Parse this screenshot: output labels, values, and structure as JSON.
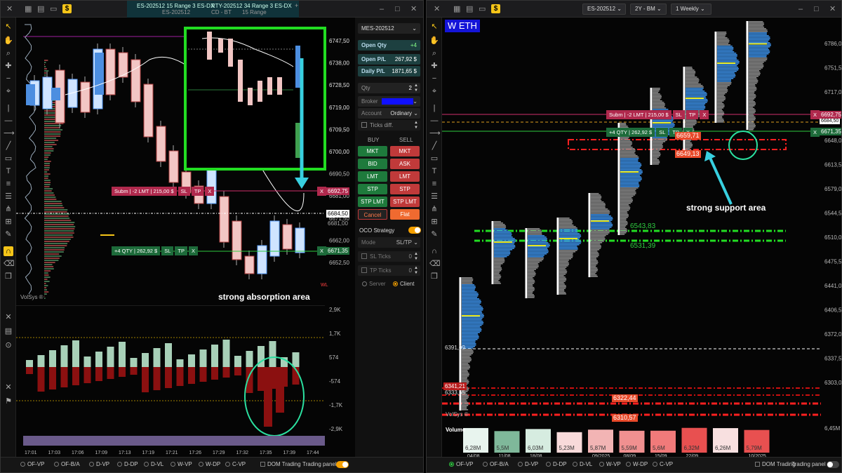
{
  "left_window": {
    "tabs": [
      "ES-202512 15 Range 3 ES-DX",
      "RTY-202512 34 Range 3 ES-DX"
    ],
    "sub_tabs": [
      "ES-202512",
      "CD - BT",
      "15 Range"
    ],
    "watermark": "VolSys ®",
    "annotation": "strong absorption area",
    "price_ticks": [
      "6747,50",
      "6738,00",
      "6728,50",
      "6719,00",
      "6709,50",
      "6700,00",
      "6690,50",
      "6681,00",
      "6671,50",
      "6662,00",
      "6652,50"
    ],
    "price_markers": {
      "p6692": "6692,75",
      "p6684": "6684,50",
      "p6671": "6671,35",
      "p6681": "6681,00",
      "wl": "WL"
    },
    "order_submit": {
      "label": "Subm | -2 LMT | 215,00 $",
      "sl": "SL",
      "tp": "TP",
      "x": "X"
    },
    "order_position": {
      "label": "+4 QTY | 262,92 $",
      "sl": "SL",
      "tp": "TP",
      "x": "X"
    },
    "delta_ticks": [
      "2,9K",
      "1,7K",
      "574",
      "-574",
      "-1,7K",
      "-2,9K"
    ],
    "time_ticks": [
      "17:01",
      "17:03",
      "17:06",
      "17:09",
      "17:13",
      "17:19",
      "17:21",
      "17:26",
      "17:29",
      "17:32",
      "17:35",
      "17:39",
      "17:44"
    ],
    "inset_ticks": [
      "6747,50",
      "6738,00",
      "6728,50",
      "6719,00",
      "6709,50",
      "6700,00"
    ],
    "bottom_items": [
      "OF-VP",
      "OF-B/A",
      "D-VP",
      "D-DP",
      "D-VL",
      "W-VP",
      "W-DP",
      "C-VP"
    ],
    "dom_trading": "DOM Trading",
    "trading_panel": "Trading panel"
  },
  "trading_panel": {
    "instrument": "MES-202512",
    "open_qty_label": "Open Qty",
    "open_qty_value": "+4",
    "open_pl_label": "Open P/L",
    "open_pl_value": "267,92 $",
    "daily_pl_label": "Daily P/L",
    "daily_pl_value": "1871,65 $",
    "qty_label": "Qty",
    "qty_value": "2",
    "broker_label": "Broker",
    "account_label": "Account",
    "account_value": "Ordinary",
    "ticks_diff_label": "Ticks diff.",
    "buy_label": "BUY",
    "sell_label": "SELL",
    "buy_buttons": [
      "MKT",
      "BID",
      "LMT",
      "STP",
      "STP LMT"
    ],
    "sell_buttons": [
      "MKT",
      "ASK",
      "LMT",
      "STP",
      "STP LMT"
    ],
    "cancel_label": "Cancel",
    "flat_label": "Flat",
    "oco_label": "OCO Strategy",
    "mode_label": "Mode",
    "mode_value": "SL/TP",
    "sl_ticks_label": "SL Ticks",
    "sl_ticks_value": "0",
    "tp_ticks_label": "TP Ticks",
    "tp_ticks_value": "0",
    "server_label": "Server",
    "client_label": "Client"
  },
  "right_window": {
    "instrument": "ES-202512",
    "range": "2Y - BM",
    "timeframe": "1 Weekly",
    "title_badge": "W ETH",
    "watermark": "VolSys ®",
    "annotation": "strong support area",
    "price_ticks": [
      "6786,00",
      "6751,50",
      "6717,00",
      "6682,50",
      "6648,00",
      "6613,50",
      "6579,00",
      "6544,50",
      "6510,00",
      "6475,50",
      "6441,00",
      "6406,50",
      "6372,00",
      "6337,50",
      "6303,00"
    ],
    "level_labels": {
      "l6659": "6659,71",
      "l6649": "6649,13",
      "l6543": "6543,83",
      "l6531": "6531,39",
      "l6391": "6391,09",
      "l6341": "6341,21",
      "l6333": "6333,65",
      "l6322": "6322,44",
      "l6310": "6310,57"
    },
    "axis_tags": {
      "t6692": "6692,75",
      "t6684": "6684,50",
      "t6671": "6671,35"
    },
    "order_submit": {
      "label": "Subm | -2 LMT | 215,00 $",
      "sl": "SL",
      "tp": "TP",
      "x": "X"
    },
    "order_position": {
      "label": "+4 QTY | 262,92 $",
      "sl": "SL",
      "tp": "TP",
      "x": "X"
    },
    "volume_label": "Volume",
    "volume_max": "6,45M",
    "volume_bars": [
      {
        "value": "6,28M",
        "date": "04/08"
      },
      {
        "value": "5,5M",
        "date": "11/08"
      },
      {
        "value": "6,03M",
        "date": "18/08"
      },
      {
        "value": "5,23M",
        "date": ""
      },
      {
        "value": "5,87M",
        "date": "09/2025"
      },
      {
        "value": "5,59M",
        "date": "08/09"
      },
      {
        "value": "5,6M",
        "date": "15/09"
      },
      {
        "value": "6,32M",
        "date": "22/09"
      },
      {
        "value": "6,26M",
        "date": ""
      },
      {
        "value": "5,79M",
        "date": "10/2025"
      }
    ],
    "bottom_items": [
      "OF-VP",
      "OF-B/A",
      "D-VP",
      "D-DP",
      "D-VL",
      "W-VP",
      "W-DP",
      "C-VP"
    ],
    "dom_trading": "DOM Trading",
    "trading_panel": "Trading panel"
  },
  "colors": {
    "bull": "#f2c6c4",
    "bear": "#c0392b",
    "green_line": "#2ecc40",
    "cyan": "#38d0e0",
    "red_level": "#ff2020",
    "accent": "#f5a000"
  }
}
